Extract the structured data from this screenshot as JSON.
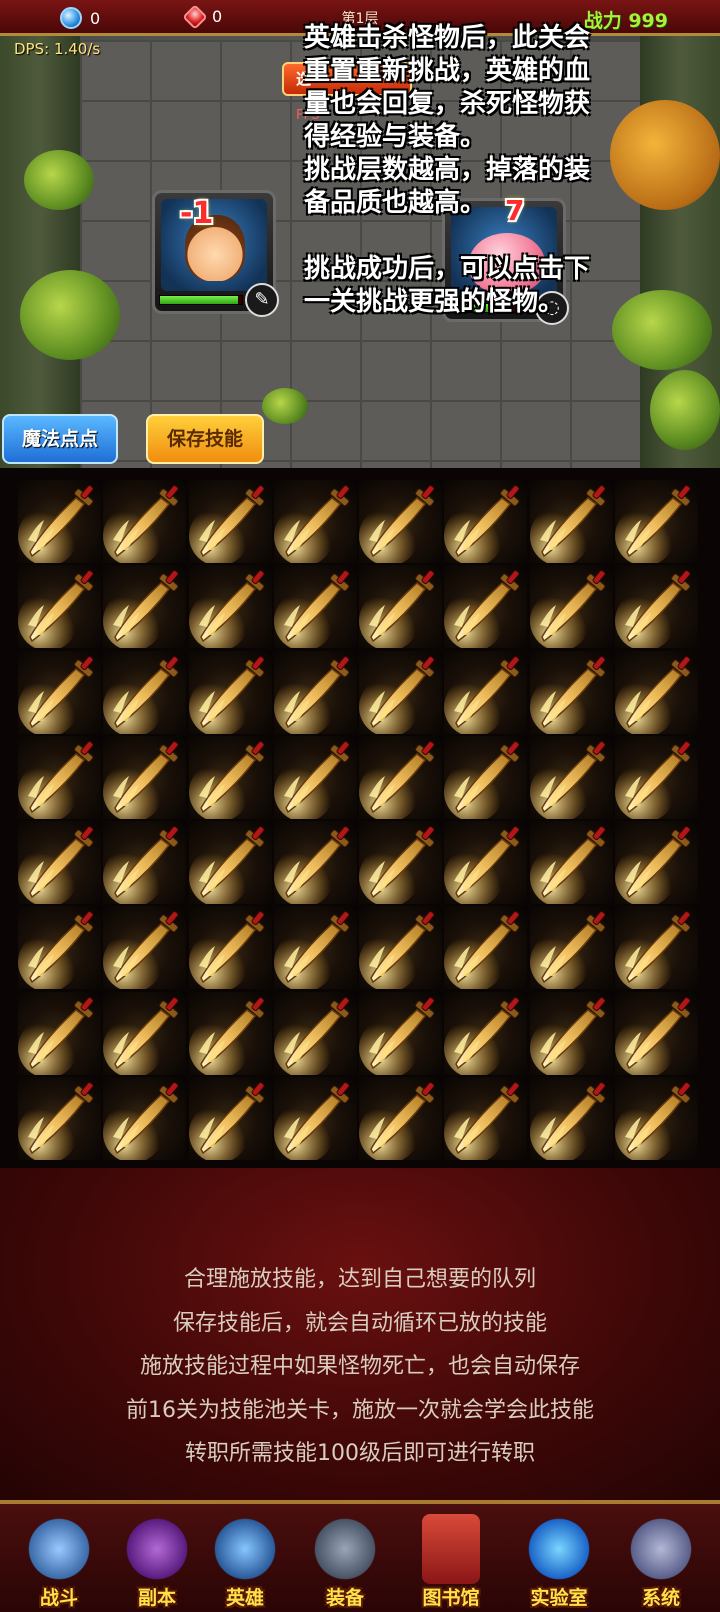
{
  "topbar": {
    "blue_gem_count": "0",
    "red_gem_count": "0",
    "floor_title": "第1层",
    "power": "战力 999"
  },
  "dps": "DPS: 1.40/s",
  "battle": {
    "select_button": "选",
    "fps": "FPS",
    "hero_damage": "-1",
    "monster_damage": "7",
    "hero_hp_fraction": 0.95,
    "monster_hp_fraction": 0.6
  },
  "help_text": {
    "para1": [
      "英雄击杀怪物后，此关会",
      "重置重新挑战，英雄的血",
      "量也会回复，杀死怪物获",
      "得经验与装备。",
      "挑战层数越高，掉落的装",
      "备品质也越高。"
    ],
    "para2": [
      "挑战成功后，可以点击下",
      "一关挑战更强的怪物。"
    ]
  },
  "buttons": {
    "magic": "魔法点点",
    "save_skill": "保存技能"
  },
  "skill_grid": {
    "rows": 8,
    "cols": 8,
    "icon": "flaming-sword-icon"
  },
  "info": [
    "合理施放技能，达到自己想要的队列",
    "保存技能后，就会自动循环已放的技能",
    "施放技能过程中如果怪物死亡，也会自动保存",
    "前16关为技能池关卡，施放一次就会学会此技能",
    "转职所需技能100级后即可进行转职"
  ],
  "nav": [
    "战斗",
    "副本",
    "英雄",
    "装备",
    "图书馆",
    "实验室",
    "系统"
  ],
  "colors": {
    "power": "#a6f23a",
    "nav_label": "#ffe14a",
    "magic_button": "#1f6fd6",
    "save_button": "#f08d10"
  }
}
